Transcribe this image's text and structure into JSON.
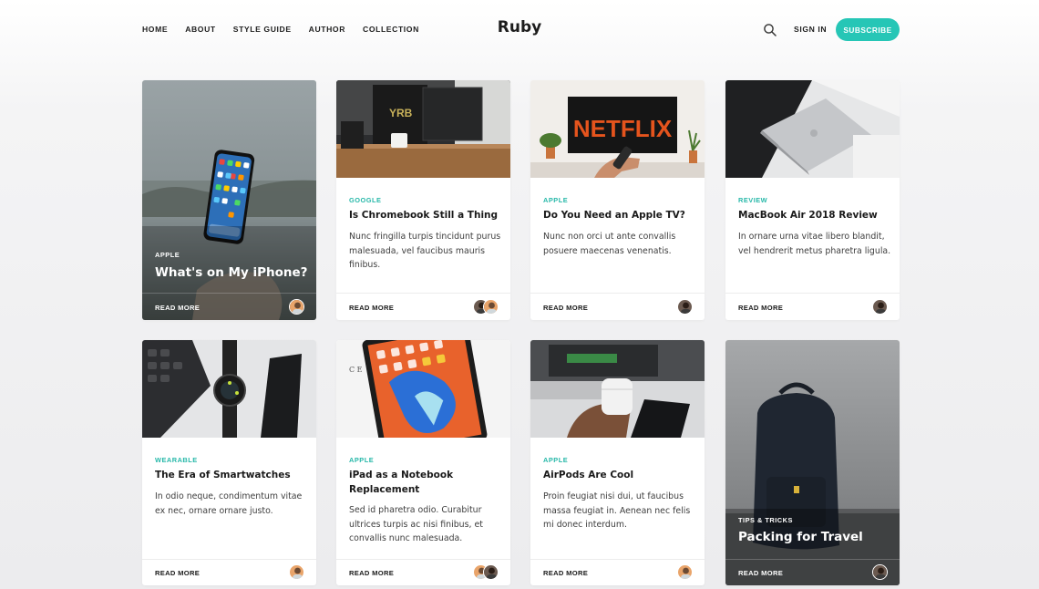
{
  "header": {
    "nav": [
      "HOME",
      "ABOUT",
      "STYLE GUIDE",
      "AUTHOR",
      "COLLECTION"
    ],
    "logo": "Ruby",
    "sign_in": "SIGN IN",
    "subscribe": "SUBSCRIBE",
    "search_icon": "search-icon",
    "accent_color": "#26c6b6"
  },
  "posts": [
    {
      "tag": "APPLE",
      "title": "What's on My iPhone?",
      "excerpt": "",
      "read_more": "READ MORE"
    },
    {
      "tag": "GOOGLE",
      "title": "Is Chromebook Still a Thing",
      "excerpt": "Nunc fringilla turpis tincidunt purus malesuada, vel faucibus mauris finibus.",
      "read_more": "READ MORE"
    },
    {
      "tag": "APPLE",
      "title": "Do You Need an Apple TV?",
      "excerpt": "Nunc non orci ut ante convallis posuere maecenas venenatis.",
      "read_more": "READ MORE",
      "image_text": "NETFLIX"
    },
    {
      "tag": "REVIEW",
      "title": "MacBook Air 2018 Review",
      "excerpt": "In ornare urna vitae libero blandit, vel hendrerit metus pharetra ligula.",
      "read_more": "READ MORE"
    },
    {
      "tag": "WEARABLE",
      "title": "The Era of Smartwatches",
      "excerpt": "In odio neque, condimentum vitae ex nec, ornare ornare justo.",
      "read_more": "READ MORE"
    },
    {
      "tag": "APPLE",
      "title": "iPad as a Notebook Replacement",
      "excerpt": "Sed id pharetra odio. Curabitur ultrices turpis ac nisi finibus, et convallis nunc malesuada.",
      "read_more": "READ MORE"
    },
    {
      "tag": "APPLE",
      "title": "AirPods Are Cool",
      "excerpt": "Proin feugiat nisi dui, ut faucibus massa feugiat in. Aenean nec felis mi donec interdum.",
      "read_more": "READ MORE"
    },
    {
      "tag": "TIPS & TRICKS",
      "title": "Packing for Travel",
      "excerpt": "",
      "read_more": "READ MORE"
    }
  ]
}
